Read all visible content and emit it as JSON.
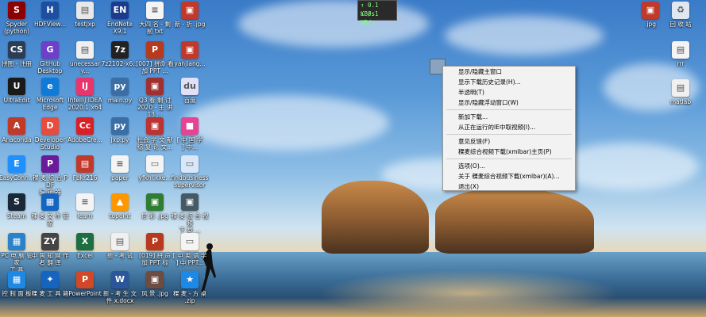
{
  "network_widget": {
    "upload": "0.1 KB/s",
    "download": "0.1 KB/s",
    "upload_arrow": "↑",
    "download_arrow": "↓"
  },
  "context_menu": {
    "items": [
      "显示/隐藏主窗口",
      "显示下载历史记录(H)...",
      "半透明(T)",
      "显示/隐藏浮动窗口(W)",
      "新加下载...",
      "从正在运行的IE中取视频(I)...",
      "意见反馈(F)",
      "稞麦综合视频下载(xmlbar)主页(P)",
      "选项(O)...",
      "关于 稞麦综合视频下载(xmlbar)(A)...",
      "退出(X)"
    ]
  },
  "desktop_icons": [
    {
      "label": "Spyder\n(python)",
      "icon": "spyder-icon",
      "color": "#8b0000",
      "glyph": "S"
    },
    {
      "label": "HDFView...",
      "icon": "hdfview-icon",
      "color": "#1d4fa1",
      "glyph": "H"
    },
    {
      "label": "testjxp",
      "icon": "file-icon",
      "color": "#e8e8e8",
      "glyph": "▤"
    },
    {
      "label": "EndNote\nX9.1",
      "icon": "endnote-icon",
      "color": "#1b3b8c",
      "glyph": "EN"
    },
    {
      "label": "大四 名 - 剩\n前 txt",
      "icon": "text-file-icon",
      "color": "#f4f4f4",
      "glyph": "≡"
    },
    {
      "label": "新 - 折 .jpg",
      "icon": "image-icon",
      "color": "#c0392b",
      "glyph": "▣"
    },
    {
      "label": "拼图 - 注册",
      "icon": "app-icon",
      "color": "#2b3d55",
      "glyph": "CS"
    },
    {
      "label": "GitHub\nDesktop",
      "icon": "github-icon",
      "color": "#6e40c9",
      "glyph": "G"
    },
    {
      "label": "unecessary...",
      "icon": "file-icon",
      "color": "#f0f0f0",
      "glyph": "▤"
    },
    {
      "label": "7z2102-x6...",
      "icon": "7zip-icon",
      "color": "#222222",
      "glyph": "7z"
    },
    {
      "label": "[007] 拼命 看\n加 PPT ...",
      "icon": "ppt-icon",
      "color": "#b73a1e",
      "glyph": "P"
    },
    {
      "label": "yanjiang...",
      "icon": "image-icon",
      "color": "#c0392b",
      "glyph": "▣"
    },
    {
      "label": "UltraEdit",
      "icon": "ultraedit-icon",
      "color": "#1a1a1a",
      "glyph": "U"
    },
    {
      "label": "Microsoft\nEdge",
      "icon": "edge-icon",
      "color": "#0f7ad8",
      "glyph": "e"
    },
    {
      "label": "IntelliJ IDEA\n2020.1 x64",
      "icon": "idea-icon",
      "color": "#e8356c",
      "glyph": "IJ"
    },
    {
      "label": "main.py",
      "icon": "python-file-icon",
      "color": "#3a6ea5",
      "glyph": "py"
    },
    {
      "label": "Q3 看 剩 讨\n2020 - 主 讲\n13 ...",
      "icon": "image-icon",
      "color": "#a03030",
      "glyph": "▣"
    },
    {
      "label": "百度",
      "icon": "baidu-icon",
      "color": "#e0e0f8",
      "glyph": "du"
    },
    {
      "label": "Anaconda",
      "icon": "anaconda-icon",
      "color": "#c03a2b",
      "glyph": "A"
    },
    {
      "label": "Developer\nStudio",
      "icon": "devstudio-icon",
      "color": "#e74c3c",
      "glyph": "D"
    },
    {
      "label": "AdobeCre...",
      "icon": "adobe-icon",
      "color": "#da1f26",
      "glyph": "Cc"
    },
    {
      "label": "jxp.py",
      "icon": "python-file-icon",
      "color": "#3a6ea5",
      "glyph": "py"
    },
    {
      "label": "社会 学 文 献\n综 复 论 文...",
      "icon": "image-icon",
      "color": "#b33",
      "glyph": "▣"
    },
    {
      "label": "[ 中 国 学\n] 中...",
      "icon": "app-icon",
      "color": "#e84393",
      "glyph": "■"
    },
    {
      "label": "EasyConn...",
      "icon": "easyconnect-icon",
      "color": "#1e90ff",
      "glyph": "E"
    },
    {
      "label": "稞 麦 综 合 PDF\n编 辑 器",
      "icon": "pdf-editor-icon",
      "color": "#6a1b9a",
      "glyph": "P"
    },
    {
      "label": "Fbkr216",
      "icon": "pdf-icon",
      "color": "#c0392b",
      "glyph": "▤"
    },
    {
      "label": "paper",
      "icon": "text-file-icon",
      "color": "#f4f4f4",
      "glyph": "≡"
    },
    {
      "label": "yfkhl.kxe...",
      "icon": "file-icon",
      "color": "#f4f4f4",
      "glyph": "▭"
    },
    {
      "label": "findbusiness\nsupervisor",
      "icon": "file-icon",
      "color": "#d8e8f8",
      "glyph": "▭"
    },
    {
      "label": "Steam",
      "icon": "steam-icon",
      "color": "#1b2838",
      "glyph": "S"
    },
    {
      "label": "稞 麦 文 件 管\n家",
      "icon": "app-icon",
      "color": "#1565c0",
      "glyph": "▦"
    },
    {
      "label": "learn",
      "icon": "text-file-icon",
      "color": "#f4f4f4",
      "glyph": "≡"
    },
    {
      "label": "topoint",
      "icon": "app-icon",
      "color": "#ff9800",
      "glyph": "▲"
    },
    {
      "label": "尼 彩 .jpg",
      "icon": "image-icon",
      "color": "#2e7d32",
      "glyph": "▣"
    },
    {
      "label": "稞 麦 综 合 视 频\n下 载 ...",
      "icon": "xmlbar-icon",
      "color": "#455a64",
      "glyph": "▣"
    },
    {
      "label": "PC 电 脑 管 家\n工 具",
      "icon": "app-icon",
      "color": "#2c82c9",
      "glyph": "▦"
    },
    {
      "label": "中 国 知 网 作\n者 翻 译",
      "icon": "app-icon",
      "color": "#444",
      "glyph": "ZY"
    },
    {
      "label": "Excel",
      "icon": "excel-icon",
      "color": "#1d6f42",
      "glyph": "X"
    },
    {
      "label": "新 - 考 试",
      "icon": "python-file-icon",
      "color": "#f0f0f0",
      "glyph": "▤"
    },
    {
      "label": "[019] 拼 命\n加 PPT 标",
      "icon": "ppt-icon",
      "color": "#b73a1e",
      "glyph": "P"
    },
    {
      "label": "[ 中 英 语 学\n] 中 PPT...",
      "icon": "file-icon",
      "color": "#f4f4f4",
      "glyph": "▭"
    },
    {
      "label": "控 制 面 板",
      "icon": "control-panel-icon",
      "color": "#1e88e5",
      "glyph": "▦"
    },
    {
      "label": "稞 麦 工 具 箱",
      "icon": "app-icon",
      "color": "#1565c0",
      "glyph": "✦"
    },
    {
      "label": "PowerPoint",
      "icon": "powerpoint-icon",
      "color": "#d24726",
      "glyph": "P"
    },
    {
      "label": "新 - 考 生 文\n件 x.docx",
      "icon": "word-icon",
      "color": "#2b579a",
      "glyph": "W"
    },
    {
      "label": "风 景 .jpg",
      "icon": "image-icon",
      "color": "#6d4c41",
      "glyph": "▣"
    },
    {
      "label": "稞 麦 - 方 桌\n.zip",
      "icon": "zip-icon",
      "color": "#1e88e5",
      "glyph": "★"
    },
    {
      "label": ".jpg",
      "icon": "image-icon",
      "color": "#c0392b",
      "glyph": "▣"
    },
    {
      "label": "回 收 站",
      "icon": "recycle-bin-icon",
      "color": "#dfe8f0",
      "glyph": "♻"
    },
    {
      "label": "rrr",
      "icon": "file-icon",
      "color": "#f4f4f4",
      "glyph": "▤"
    },
    {
      "label": "matlab",
      "icon": "python-file-icon",
      "color": "#f0f0f0",
      "glyph": "▤"
    }
  ]
}
